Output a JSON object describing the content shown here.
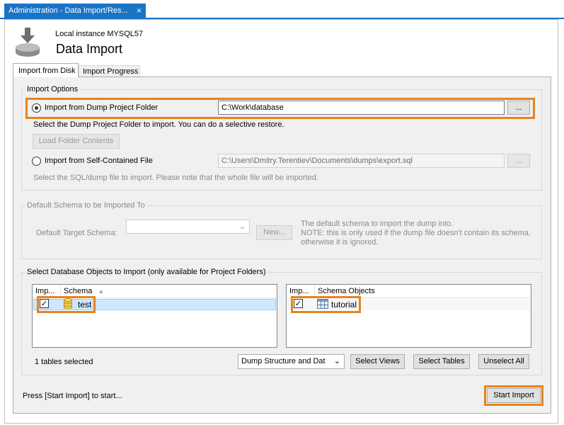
{
  "window_tab": {
    "title": "Administration - Data Import/Res...",
    "close": "×"
  },
  "header": {
    "instance": "Local instance MYSQL57",
    "title": "Data Import"
  },
  "tabs": [
    {
      "label": "Import from Disk",
      "active": true
    },
    {
      "label": "Import Progress",
      "active": false
    }
  ],
  "import_options": {
    "group_label": "Import Options",
    "dump_folder": {
      "label": "Import from Dump Project Folder",
      "value": "C:\\Work\\database",
      "browse": "...",
      "selected": true
    },
    "dump_folder_hint": "Select the Dump Project Folder to import. You can do a selective restore.",
    "load_folder_button": "Load Folder Contents",
    "self_contained": {
      "label": "Import from Self-Contained File",
      "value": "C:\\Users\\Dmitry.Terentiev\\Documents\\dumps\\export.sql",
      "browse": "...",
      "selected": false
    },
    "self_contained_hint": "Select the SQL/dump file to import. Please note that the whole file will be imported."
  },
  "default_schema": {
    "group_label": "Default Schema to be Imported To",
    "target_label": "Default Target Schema:",
    "target_value": "",
    "new_button": "New...",
    "note_line1": "The default schema to import the dump into.",
    "note_line2": "NOTE: this is only used if the dump file doesn't contain its schema,",
    "note_line3": "otherwise it is ignored."
  },
  "objects": {
    "group_label": "Select Database Objects to Import (only available for Project Folders)",
    "schema_list": {
      "col_import": "Imp...",
      "col_name": "Schema",
      "rows": [
        {
          "checked": true,
          "name": "test"
        }
      ]
    },
    "objects_list": {
      "col_import": "Imp...",
      "col_name": "Schema Objects",
      "rows": [
        {
          "checked": true,
          "name": "tutorial"
        }
      ]
    },
    "selected_count": "1 tables selected",
    "dump_mode": "Dump Structure and Dat",
    "select_views": "Select Views",
    "select_tables": "Select Tables",
    "unselect_all": "Unselect All"
  },
  "footer": {
    "status": "Press [Start Import] to start...",
    "start_button": "Start Import"
  },
  "colors": {
    "accent": "#1a74c6",
    "highlight": "#e8831e"
  }
}
